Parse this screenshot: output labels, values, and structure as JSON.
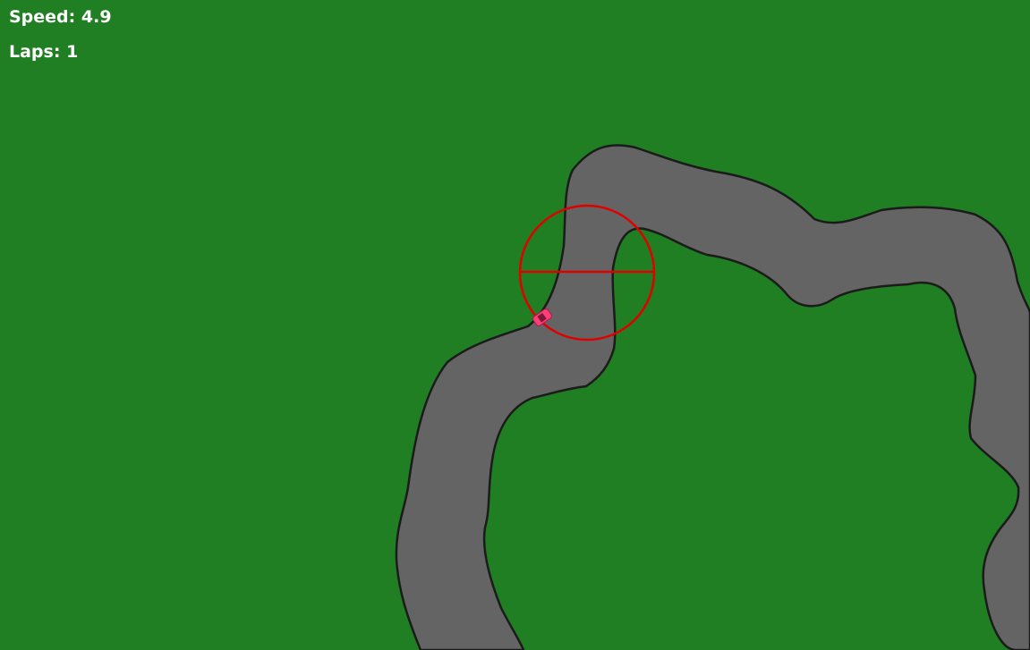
{
  "hud": {
    "speed_label": "Speed:",
    "speed_value": "4.9",
    "laps_label": "Laps:",
    "laps_value": "1"
  },
  "colors": {
    "grass": "#207f22",
    "track": "#646464",
    "track_edge": "#1b1b1b",
    "checkpoint": "#e00000",
    "car": "#ff3f79"
  },
  "icons": {
    "car": "car-icon",
    "checkpoint": "checkpoint-target-icon"
  }
}
